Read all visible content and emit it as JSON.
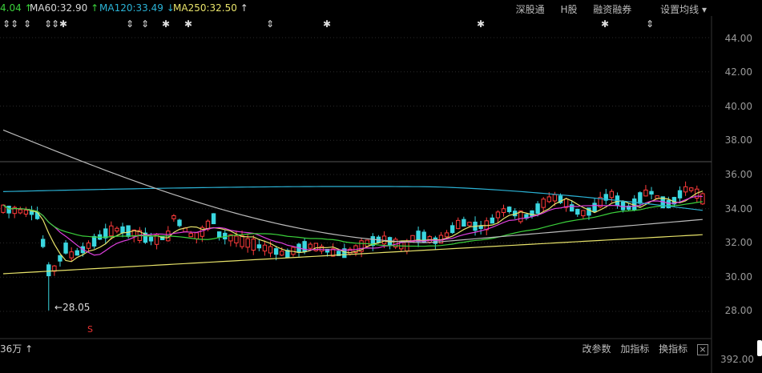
{
  "ma_legend": [
    {
      "id": "ma30",
      "label": "4.04",
      "arrow": "↑",
      "color": "#3bd13b"
    },
    {
      "id": "ma60",
      "label": "MA60:32.90",
      "arrow": "↑",
      "color": "#d8d8d8"
    },
    {
      "id": "ma120",
      "label": "MA120:33.49",
      "arrow": "↓",
      "color": "#2bb3d6"
    },
    {
      "id": "ma250",
      "label": "MA250:32.50",
      "arrow": "↑",
      "color": "#e8e36a"
    }
  ],
  "header_links": [
    "深股通",
    "H股",
    "融资融券",
    "设置均线"
  ],
  "y_axis": {
    "ticks": [
      "44.00",
      "42.00",
      "40.00",
      "38.00",
      "36.00",
      "34.00",
      "32.00",
      "30.00",
      "28.00"
    ]
  },
  "volume_label": "36万",
  "volume_arrow": "↑",
  "low_annotation": "28.05",
  "s_marker": "S",
  "bottom_tools": [
    "改参数",
    "加指标",
    "换指标"
  ],
  "close_glyph": "×",
  "volume_axis": "392.00",
  "marker_glyphs": [
    "⇕",
    "⇕",
    "⇕",
    "⇕",
    "⇕✱",
    "⇕",
    "⇕",
    "✱",
    "✱",
    "⇕",
    "✱",
    "✱",
    "✱",
    "⇕"
  ],
  "chart_data": {
    "type": "line",
    "ylim": [
      27,
      45
    ],
    "series": [],
    "candles": [
      {
        "o": 34.2,
        "c": 33.8,
        "h": 34.5,
        "l": 33.6
      },
      {
        "o": 33.9,
        "c": 34.1,
        "h": 34.3,
        "l": 33.7
      },
      {
        "o": 34.0,
        "c": 33.7,
        "h": 34.2,
        "l": 33.5
      },
      {
        "o": 33.8,
        "c": 34.3,
        "h": 34.5,
        "l": 33.7
      },
      {
        "o": 34.2,
        "c": 34.0,
        "h": 34.4,
        "l": 33.8
      },
      {
        "o": 33.9,
        "c": 33.6,
        "h": 34.1,
        "l": 33.4
      },
      {
        "o": 32.0,
        "c": 31.3,
        "h": 32.2,
        "l": 31.1
      },
      {
        "o": 31.3,
        "c": 30.2,
        "h": 31.5,
        "l": 30.0
      },
      {
        "o": 30.2,
        "c": 28.9,
        "h": 30.4,
        "l": 28.05
      },
      {
        "o": 30.8,
        "c": 31.6,
        "h": 31.9,
        "l": 30.6
      },
      {
        "o": 31.6,
        "c": 32.1,
        "h": 32.3,
        "l": 31.4
      },
      {
        "o": 32.0,
        "c": 31.7,
        "h": 32.2,
        "l": 31.5
      }
    ]
  }
}
